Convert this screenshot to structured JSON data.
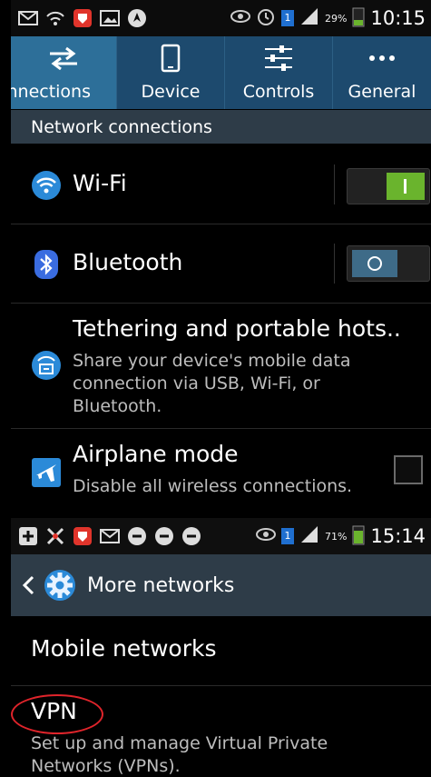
{
  "top_screen": {
    "statusbar": {
      "battery_percent": "29%",
      "time": "10:15",
      "sim_badge": "1",
      "left_icons": [
        "envelope-icon",
        "wifi-call-icon",
        "shield-app-icon",
        "gallery-icon",
        "navigation-icon"
      ],
      "right_icons": [
        "eye-icon",
        "alarm-icon",
        "sim-icon",
        "signal-icon",
        "battery-icon"
      ]
    },
    "tabs": [
      {
        "label": "Connections",
        "icon": "swap-arrows-icon",
        "active": true
      },
      {
        "label": "Device",
        "icon": "phone-icon",
        "active": false
      },
      {
        "label": "Controls",
        "icon": "sliders-icon",
        "active": false
      },
      {
        "label": "General",
        "icon": "more-dots-icon",
        "active": false
      }
    ],
    "section_header": "Network connections",
    "items": [
      {
        "title": "Wi-Fi",
        "icon": "wifi-icon",
        "toggle": "on"
      },
      {
        "title": "Bluetooth",
        "icon": "bluetooth-icon",
        "toggle": "off"
      },
      {
        "title": "Tethering and portable hots..",
        "subtitle": "Share your device's mobile data connection via USB, Wi-Fi, or Bluetooth.",
        "icon": "tethering-icon"
      },
      {
        "title": "Airplane mode",
        "subtitle": "Disable all wireless connections.",
        "icon": "airplane-icon",
        "checked": false
      }
    ]
  },
  "bottom_screen": {
    "statusbar": {
      "battery_percent": "71%",
      "time": "15:14",
      "sim_badge": "1",
      "left_icons": [
        "add-icon",
        "tools-icon",
        "shield-app-icon",
        "envelope-icon",
        "chat-icon",
        "chat-icon",
        "chat-icon"
      ],
      "right_icons": [
        "eye-icon",
        "sim-icon",
        "signal-icon",
        "battery-icon"
      ]
    },
    "actionbar": {
      "title": "More networks",
      "icons": [
        "back-chevron-icon",
        "gear-icon"
      ]
    },
    "items": [
      {
        "title": "Mobile networks"
      },
      {
        "title": "VPN",
        "subtitle": "Set up and manage Virtual Private Networks (VPNs).",
        "highlighted": true
      }
    ]
  },
  "colors": {
    "tab_bar": "#1d4a6e",
    "tab_active": "#2d6f99",
    "header": "#2e3c48",
    "toggle_on": "#6ab42d",
    "highlight": "#e0242b"
  }
}
